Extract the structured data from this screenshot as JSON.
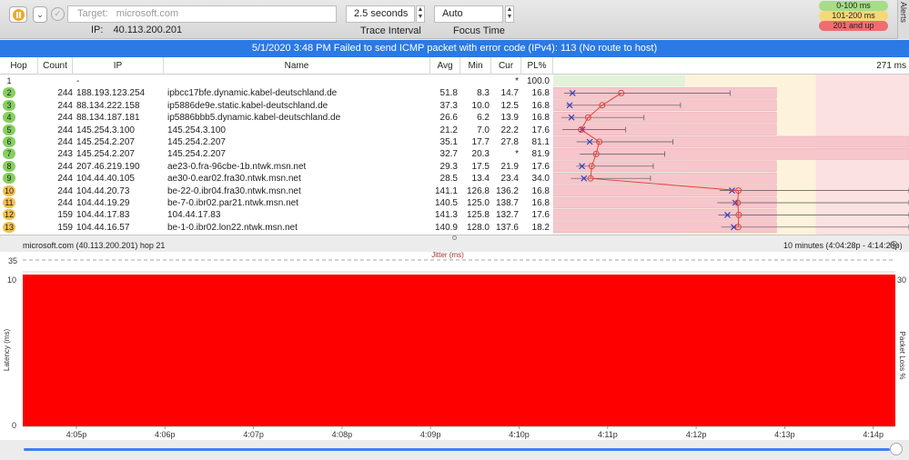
{
  "toolbar": {
    "target_label": "Target:",
    "target_value": "microsoft.com",
    "ip_label": "IP:",
    "ip_value": "40.113.200.201",
    "trace_interval_value": "2.5 seconds",
    "trace_interval_label": "Trace Interval",
    "focus_time_value": "Auto",
    "focus_time_label": "Focus Time",
    "legend": [
      {
        "label": "0-100 ms",
        "color": "#a8dc88"
      },
      {
        "label": "101-200 ms",
        "color": "#f7d77a"
      },
      {
        "label": "201 and up",
        "color": "#ee6e6e"
      }
    ],
    "alerts_label": "Alerts"
  },
  "banner": "5/1/2020 3:48 PM Failed to send ICMP packet with error code (IPv4): 113 (No route to host)",
  "table": {
    "headers": {
      "hop": "Hop",
      "count": "Count",
      "ip": "IP",
      "name": "Name",
      "avg": "Avg",
      "min": "Min",
      "cur": "Cur",
      "pl": "PL%"
    },
    "scale_label": "271 ms",
    "rows": [
      {
        "hop": "1",
        "count": "",
        "ip": "-",
        "name": "",
        "avg": "",
        "min": "",
        "cur": "*",
        "pl": "100.0",
        "status": "none"
      },
      {
        "hop": "2",
        "count": "244",
        "ip": "188.193.123.254",
        "name": "ipbcc17bfe.dynamic.kabel-deutschland.de",
        "avg": "51.8",
        "min": "8.3",
        "cur": "14.7",
        "pl": "16.8",
        "status": "green"
      },
      {
        "hop": "3",
        "count": "244",
        "ip": "88.134.222.158",
        "name": "ip5886de9e.static.kabel-deutschland.de",
        "avg": "37.3",
        "min": "10.0",
        "cur": "12.5",
        "pl": "16.8",
        "status": "green"
      },
      {
        "hop": "4",
        "count": "244",
        "ip": "88.134.187.181",
        "name": "ip5886bbb5.dynamic.kabel-deutschland.de",
        "avg": "26.6",
        "min": "6.2",
        "cur": "13.9",
        "pl": "16.8",
        "status": "green"
      },
      {
        "hop": "5",
        "count": "244",
        "ip": "145.254.3.100",
        "name": "145.254.3.100",
        "avg": "21.2",
        "min": "7.0",
        "cur": "22.2",
        "pl": "17.6",
        "status": "green"
      },
      {
        "hop": "6",
        "count": "244",
        "ip": "145.254.2.207",
        "name": "145.254.2.207",
        "avg": "35.1",
        "min": "17.7",
        "cur": "27.8",
        "pl": "81.1",
        "status": "green"
      },
      {
        "hop": "7",
        "count": "243",
        "ip": "145.254.2.207",
        "name": "145.254.2.207",
        "avg": "32.7",
        "min": "20.3",
        "cur": "*",
        "pl": "81.9",
        "status": "green"
      },
      {
        "hop": "8",
        "count": "244",
        "ip": "207.46.219.190",
        "name": "ae23-0.fra-96cbe-1b.ntwk.msn.net",
        "avg": "29.3",
        "min": "17.5",
        "cur": "21.9",
        "pl": "17.6",
        "status": "green"
      },
      {
        "hop": "9",
        "count": "244",
        "ip": "104.44.40.105",
        "name": "ae30-0.ear02.fra30.ntwk.msn.net",
        "avg": "28.5",
        "min": "13.4",
        "cur": "23.4",
        "pl": "34.0",
        "status": "green"
      },
      {
        "hop": "10",
        "count": "244",
        "ip": "104.44.20.73",
        "name": "be-22-0.ibr04.fra30.ntwk.msn.net",
        "avg": "141.1",
        "min": "126.8",
        "cur": "136.2",
        "pl": "16.8",
        "status": "yellow"
      },
      {
        "hop": "11",
        "count": "244",
        "ip": "104.44.19.29",
        "name": "be-7-0.ibr02.par21.ntwk.msn.net",
        "avg": "140.5",
        "min": "125.0",
        "cur": "138.7",
        "pl": "16.8",
        "status": "yellow"
      },
      {
        "hop": "12",
        "count": "159",
        "ip": "104.44.17.83",
        "name": "104.44.17.83",
        "avg": "141.3",
        "min": "125.8",
        "cur": "132.7",
        "pl": "17.6",
        "status": "yellow"
      },
      {
        "hop": "13",
        "count": "159",
        "ip": "104.44.16.57",
        "name": "be-1-0.ibr02.lon22.ntwk.msn.net",
        "avg": "140.9",
        "min": "128.0",
        "cur": "137.6",
        "pl": "18.2",
        "status": "yellow"
      }
    ]
  },
  "bottom": {
    "title": "microsoft.com (40.113.200.201) hop 21",
    "range": "10 minutes (4:04:28p - 4:14:28p)",
    "jitter_label": "Jitter (ms)",
    "jitter_value": "35",
    "latency_label": "Latency (ms)",
    "packet_loss_label": "Packet Loss %",
    "y_max": "10",
    "y_min": "0",
    "pl_max": "30",
    "fill_color": "#ff0000",
    "time_ticks": [
      "4:05p",
      "4:06p",
      "4:07p",
      "4:08p",
      "4:09p",
      "4:10p",
      "4:11p",
      "4:12p",
      "4:13p",
      "4:14p"
    ]
  }
}
